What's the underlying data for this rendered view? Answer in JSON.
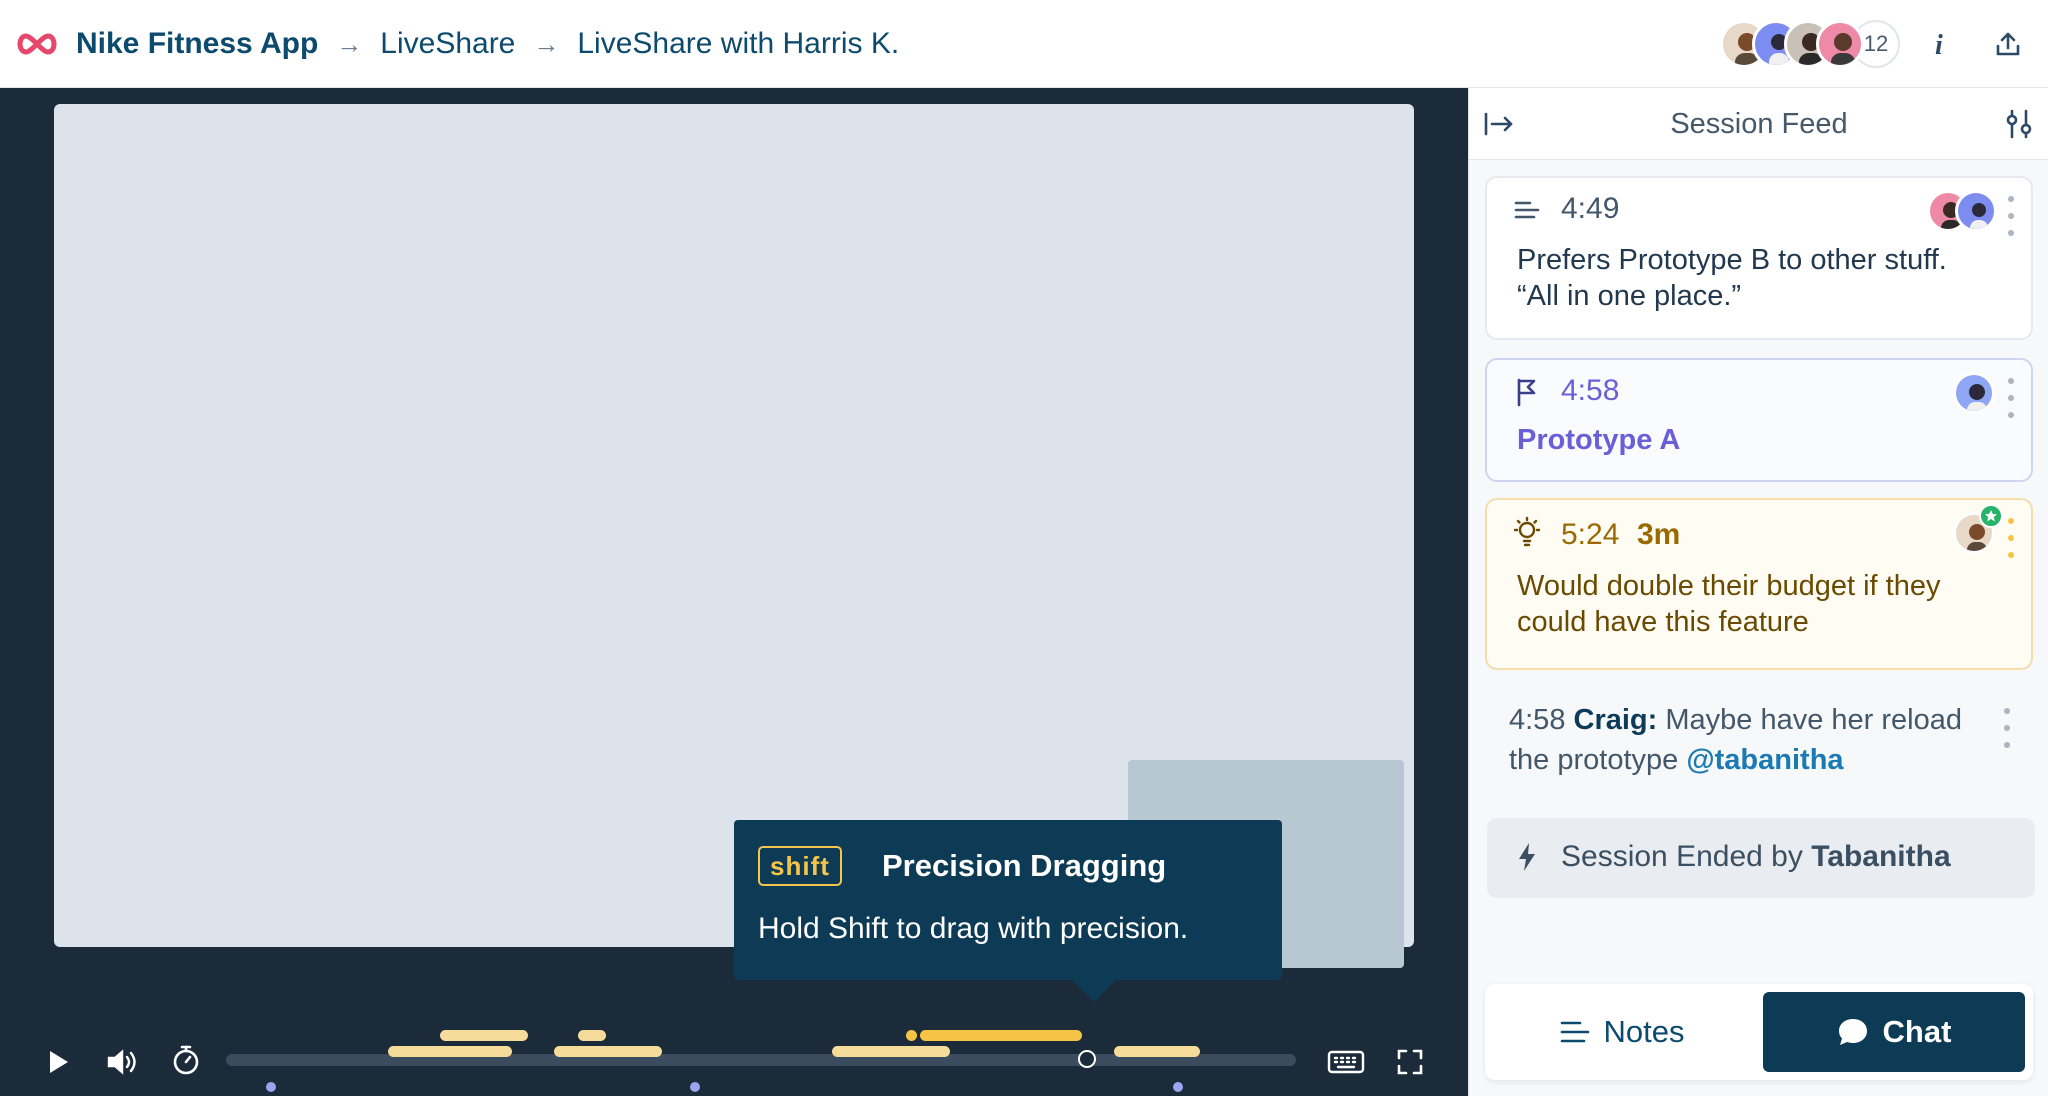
{
  "header": {
    "app_name": "Nike Fitness App",
    "breadcrumb_sep": "→",
    "crumbs": [
      "LiveShare",
      "LiveShare with Harris K."
    ],
    "participant_count": "12"
  },
  "tooltip": {
    "key": "shift",
    "title": "Precision Dragging",
    "body": "Hold Shift to drag with precision."
  },
  "player": {
    "progress": 0.805
  },
  "panel": {
    "title": "Session Feed",
    "cards": [
      {
        "type": "note",
        "time": "4:49",
        "text": "Prefers Prototype B to other stuff. “All in one place.”"
      },
      {
        "type": "flag",
        "time": "4:58",
        "text": "Prototype A"
      },
      {
        "type": "idea",
        "time": "5:24",
        "duration": "3m",
        "text": "Would double their budget if they could have this feature"
      }
    ],
    "chat": {
      "time": "4:58",
      "author": "Craig:",
      "text": "Maybe have her reload the prototype",
      "mention": "@tabanitha"
    },
    "ended": {
      "prefix": "Session Ended by",
      "name": "Tabanitha"
    },
    "tabs": {
      "notes": "Notes",
      "chat": "Chat"
    }
  },
  "colors": {
    "brand_navy": "#0d3a55",
    "accent_pink": "#e5486a",
    "highlight_yellow": "#f6c445",
    "flag_purple": "#6a5fd6",
    "idea_brown": "#9a6a00"
  }
}
